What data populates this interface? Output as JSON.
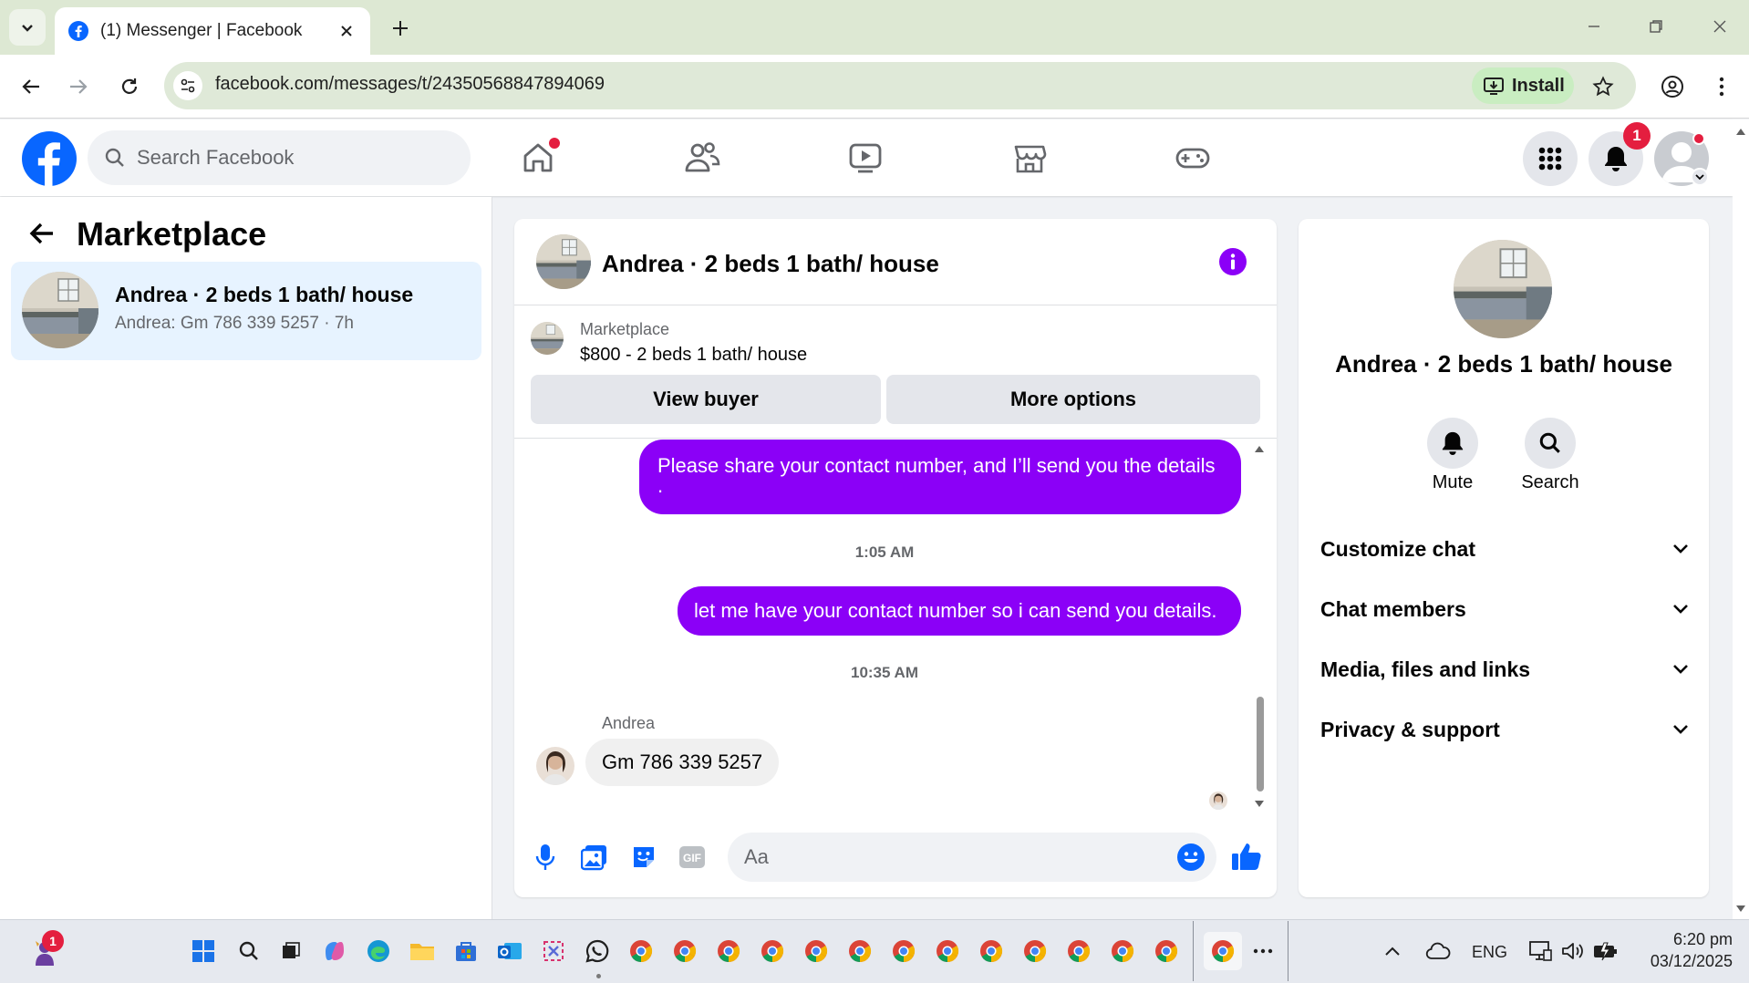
{
  "browser": {
    "tab_title": "(1) Messenger | Facebook",
    "url": "facebook.com/messages/t/24350568847894069",
    "install_label": "Install"
  },
  "fb": {
    "search_placeholder": "Search Facebook",
    "notification_count": "1"
  },
  "sidebar": {
    "title": "Marketplace",
    "conversations": [
      {
        "name": "Andrea · 2 beds 1 bath/ house",
        "preview": "Andrea: Gm 786 339 5257 · 7h"
      }
    ]
  },
  "chat": {
    "title": "Andrea · 2 beds 1 bath/ house",
    "listing_label": "Marketplace",
    "listing_title": "$800 - 2 beds 1 bath/ house",
    "view_buyer": "View buyer",
    "more_options": "More options",
    "messages": [
      {
        "from": "me",
        "text": "Please share your contact number, and I’ll send you the details",
        "text2": "."
      },
      {
        "type": "time",
        "text": "1:05 AM"
      },
      {
        "from": "me",
        "text": "let me have your contact number so i can send you details."
      },
      {
        "type": "time",
        "text": "10:35 AM"
      },
      {
        "from": "Andrea",
        "sender": "Andrea",
        "text": "Gm 786 339 5257"
      }
    ],
    "composer_placeholder": "Aa"
  },
  "details": {
    "name": "Andrea · 2 beds 1 bath/ house",
    "mute": "Mute",
    "search": "Search",
    "sections": [
      "Customize chat",
      "Chat members",
      "Media, files and links",
      "Privacy & support"
    ]
  },
  "taskbar": {
    "app_badge": "1",
    "language": "ENG",
    "time": "6:20 pm",
    "date": "03/12/2025"
  },
  "colors": {
    "accent_purple": "#8b00f7",
    "fb_blue": "#0866ff",
    "selected_bg": "#e7f3ff"
  }
}
